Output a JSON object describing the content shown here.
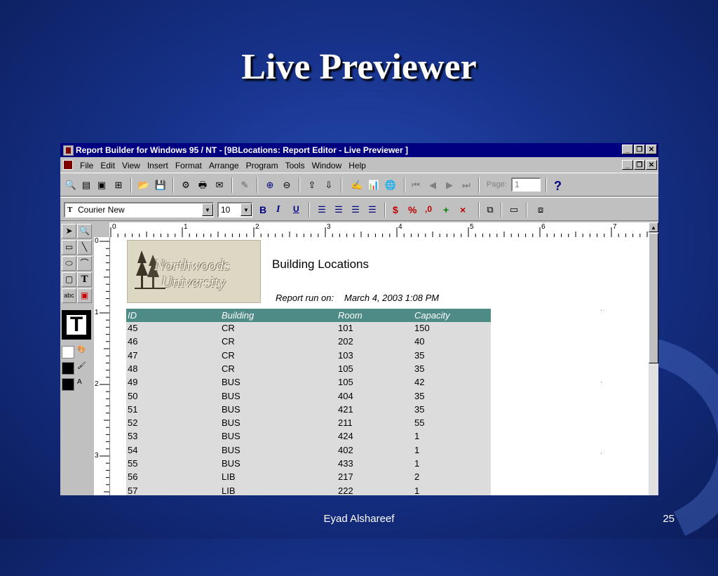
{
  "slide": {
    "title": "Live Previewer",
    "footer": "Eyad Alshareef",
    "page": "25"
  },
  "window": {
    "title": "Report Builder for Windows 95 / NT - [9BLocations: Report Editor - Live Previewer ]",
    "buttons": {
      "minimize": "_",
      "restore": "❐",
      "close": "✕"
    }
  },
  "menu": [
    "File",
    "Edit",
    "View",
    "Insert",
    "Format",
    "Arrange",
    "Program",
    "Tools",
    "Window",
    "Help"
  ],
  "toolbar": {
    "page_label": "Page:",
    "page_value": "1",
    "help": "?"
  },
  "format_bar": {
    "font": "Courier New",
    "font_glyph": "T",
    "size": "10",
    "bold": "B",
    "italic": "I",
    "underline": "U",
    "currency": "$",
    "percent": "%",
    "comma": ",0",
    "add_decimal": "+",
    "remove_decimal": "×"
  },
  "palette": {
    "text_tool": "T",
    "big_text": "T",
    "label": "abc"
  },
  "ruler": {
    "h": [
      "0",
      "1",
      "2",
      "3",
      "4",
      "5",
      "6",
      "7"
    ],
    "v": [
      "0",
      "1",
      "2",
      "3"
    ]
  },
  "report": {
    "logo_line1": "Northwoods",
    "logo_line2": "University",
    "title": "Building Locations",
    "run_label": "Report run on:",
    "run_value": "March 4, 2003 1:08 PM",
    "columns": [
      "ID",
      "Building",
      "Room",
      "Capacity"
    ],
    "rows": [
      [
        "45",
        "CR",
        "101",
        "150"
      ],
      [
        "46",
        "CR",
        "202",
        "40"
      ],
      [
        "47",
        "CR",
        "103",
        "35"
      ],
      [
        "48",
        "CR",
        "105",
        "35"
      ],
      [
        "49",
        "BUS",
        "105",
        "42"
      ],
      [
        "50",
        "BUS",
        "404",
        "35"
      ],
      [
        "51",
        "BUS",
        "421",
        "35"
      ],
      [
        "52",
        "BUS",
        "211",
        "55"
      ],
      [
        "53",
        "BUS",
        "424",
        "1"
      ],
      [
        "54",
        "BUS",
        "402",
        "1"
      ],
      [
        "55",
        "BUS",
        "433",
        "1"
      ],
      [
        "56",
        "LIB",
        "217",
        "2"
      ],
      [
        "57",
        "LIB",
        "222",
        "1"
      ]
    ]
  },
  "colors": {
    "slide_bg": "#17338c",
    "titlebar": "#000080",
    "header_bg": "#4e8a86",
    "row_bg": "#dcdcdc"
  }
}
